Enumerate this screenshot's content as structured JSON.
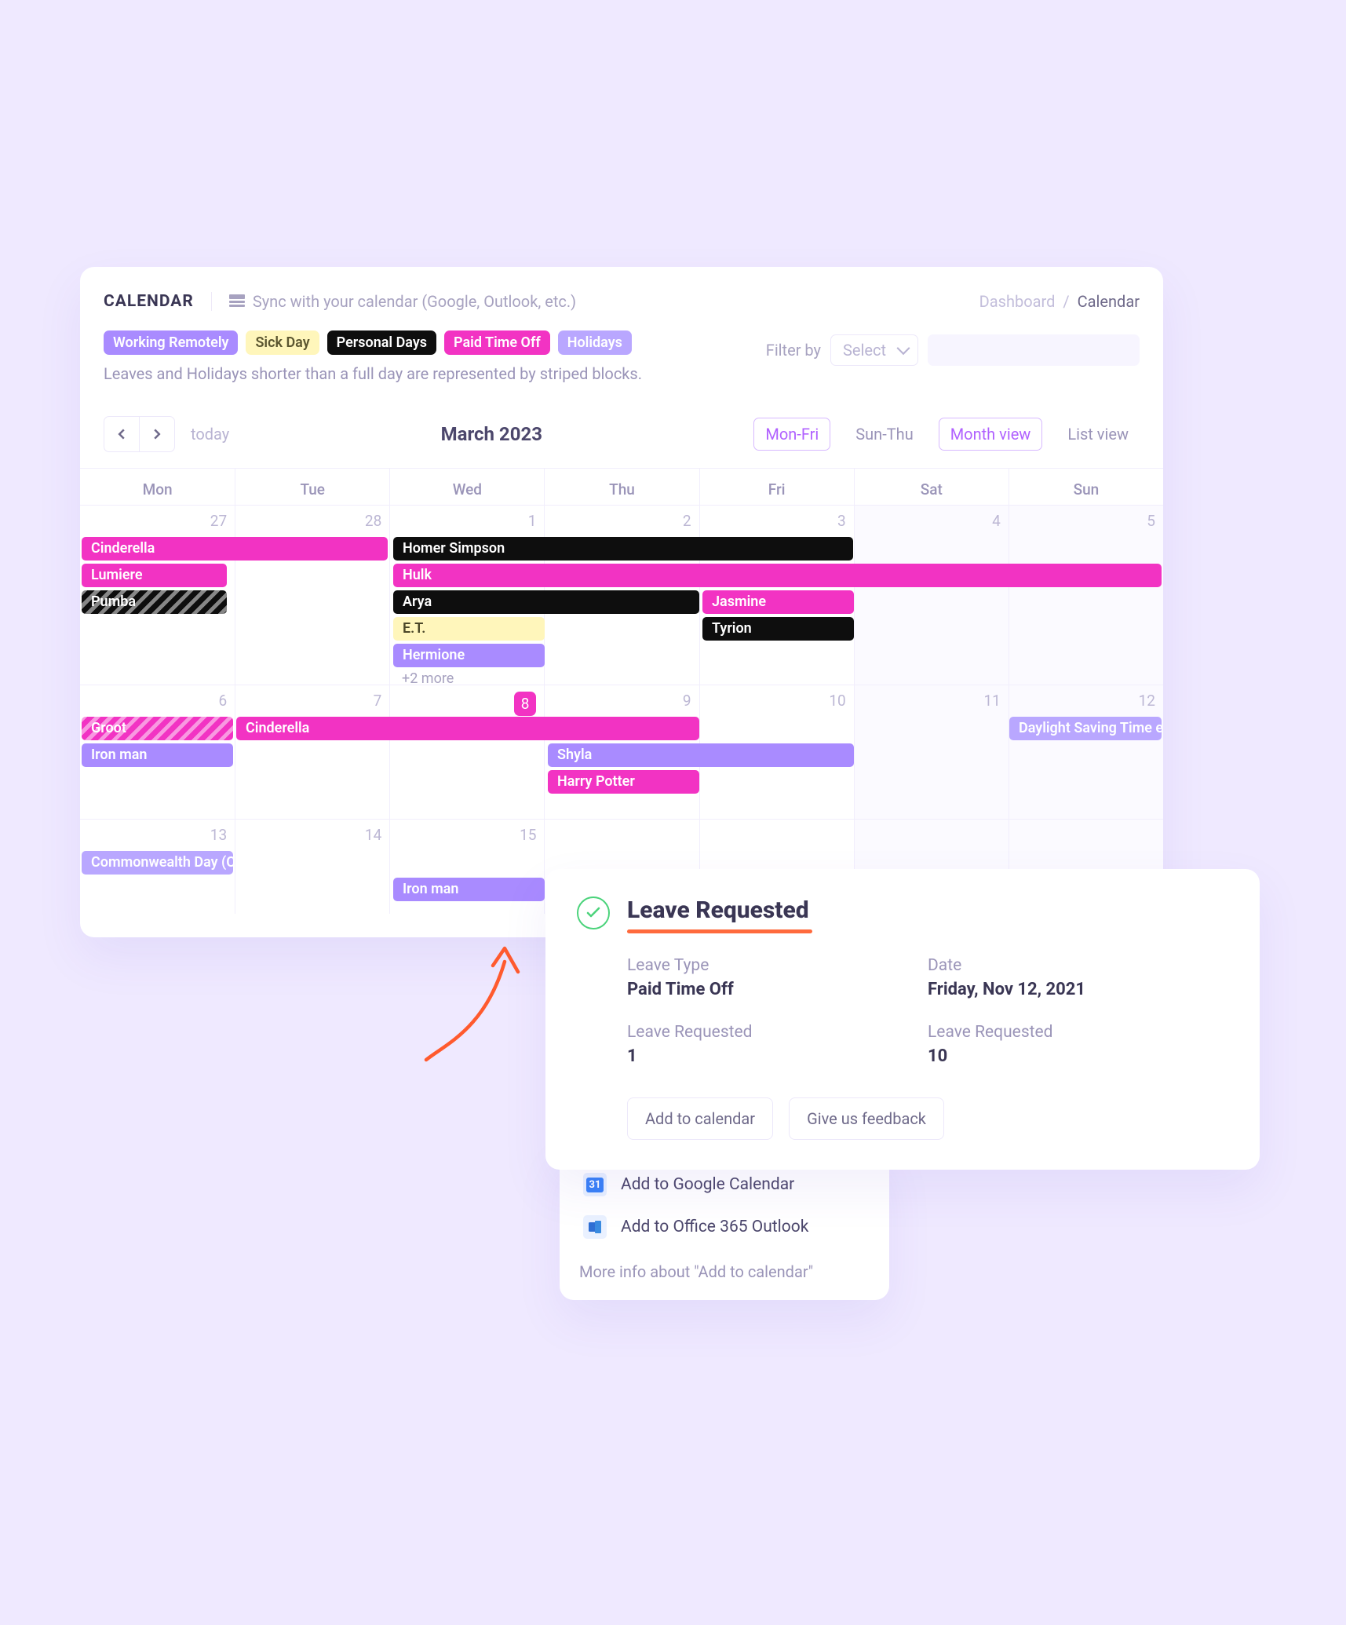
{
  "calendar": {
    "title": "CALENDAR",
    "sync": "Sync with your calendar (Google, Outlook, etc.)",
    "breadcrumb": {
      "root": "Dashboard",
      "sep": "/",
      "current": "Calendar"
    },
    "legend": {
      "wr": "Working Remotely",
      "sick": "Sick Day",
      "pers": "Personal Days",
      "pto": "Paid Time Off",
      "hol": "Holidays"
    },
    "legend_note": "Leaves and Holidays shorter than a full day are represented by striped blocks.",
    "filter": {
      "label": "Filter by",
      "placeholder": "Select"
    },
    "today": "today",
    "month_label": "March 2023",
    "view": {
      "monfri": "Mon-Fri",
      "sunthu": "Sun-Thu",
      "month": "Month view",
      "list": "List view"
    },
    "dow": [
      "Mon",
      "Tue",
      "Wed",
      "Thu",
      "Fri",
      "Sat",
      "Sun"
    ],
    "days_row1": [
      "27",
      "28",
      "1",
      "2",
      "3",
      "4",
      "5"
    ],
    "days_row2": [
      "6",
      "7",
      "8",
      "9",
      "10",
      "11",
      "12"
    ],
    "days_row3": [
      "13",
      "14",
      "15"
    ],
    "row1_events": {
      "cinderella": "Cinderella",
      "lumiere": "Lumiere",
      "pumba": "Pumba",
      "homer": "Homer Simpson",
      "hulk": "Hulk",
      "arya": "Arya",
      "et": "E.T.",
      "hermione": "Hermione",
      "more": "+2 more",
      "jasmine": "Jasmine",
      "tyrion": "Tyrion"
    },
    "row2_events": {
      "groot": "Groot",
      "ironman": "Iron man",
      "cinderella": "Cinderella",
      "shyla": "Shyla",
      "harry": "Harry Potter",
      "dst": "Daylight Saving Time e"
    },
    "row3_events": {
      "comm": "Commonwealth Day (C",
      "ironman": "Iron man"
    }
  },
  "leave": {
    "title": "Leave Requested",
    "type_lbl": "Leave Type",
    "type_val": "Paid Time Off",
    "date_lbl": "Date",
    "date_val": "Friday, Nov 12, 2021",
    "req_lbl": "Leave Requested",
    "req_val": "1",
    "req2_lbl": "Leave Requested",
    "req2_val": "10",
    "add_btn": "Add to calendar",
    "feedback_btn": "Give us feedback"
  },
  "addcal": {
    "gcal": "Add to Google Calendar",
    "gcal_num": "31",
    "outlook": "Add to Office 365 Outlook",
    "more": "More info about \"Add to calendar\""
  }
}
